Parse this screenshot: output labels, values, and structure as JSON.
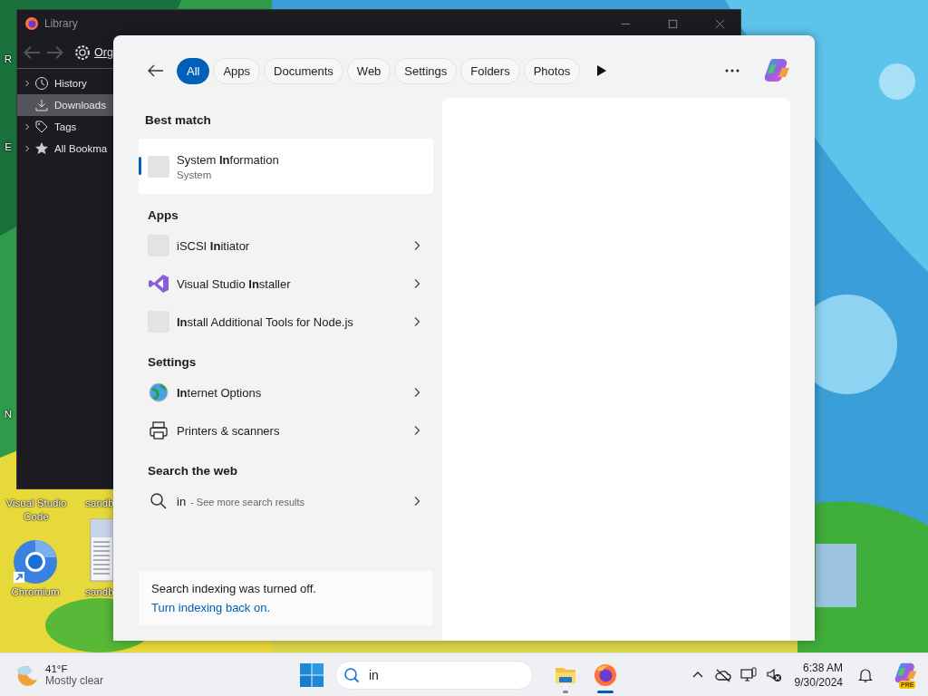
{
  "desktop_icons": [
    {
      "label": "R",
      "kind": "cut"
    },
    {
      "label": "E",
      "kind": "cut"
    },
    {
      "label": "N",
      "kind": "cut"
    },
    {
      "label": "Visual Studio Code",
      "kind": "vscode"
    },
    {
      "label": "sandb",
      "kind": "cut"
    },
    {
      "label": "Chromium",
      "kind": "chromium"
    },
    {
      "label": "sandb",
      "kind": "document"
    }
  ],
  "library_window": {
    "title": "Library",
    "navigation": [
      {
        "kind": "back",
        "disabled": true
      },
      {
        "kind": "forward",
        "disabled": true
      }
    ],
    "organize": "Org",
    "sidebar": [
      {
        "label": "History",
        "kind": "history",
        "expanded": false,
        "selected": false
      },
      {
        "label": "Downloads",
        "kind": "downloads",
        "selected": true
      },
      {
        "label": "Tags",
        "kind": "tags",
        "expanded": false,
        "selected": false
      },
      {
        "label": "All Bookma",
        "kind": "bookmarks",
        "expanded": false,
        "selected": false
      }
    ]
  },
  "search_panel": {
    "filters": [
      {
        "label": "All",
        "selected": true
      },
      {
        "label": "Apps",
        "selected": false
      },
      {
        "label": "Documents",
        "selected": false
      },
      {
        "label": "Web",
        "selected": false
      },
      {
        "label": "Settings",
        "selected": false
      },
      {
        "label": "Folders",
        "selected": false
      },
      {
        "label": "Photos",
        "selected": false
      }
    ],
    "sections": [
      {
        "title": "Best match",
        "items": [
          {
            "kind": "blank",
            "title": "System **In**formation",
            "subtitle": "System",
            "selected": true
          }
        ]
      },
      {
        "title": "Apps",
        "items": [
          {
            "kind": "blank",
            "title": "iSCSI **In**itiator",
            "selected": false
          },
          {
            "kind": "vs",
            "title": "Visual Studio **In**staller",
            "selected": false
          },
          {
            "kind": "blank",
            "title": "**In**stall Additional Tools for Node.js",
            "selected": false
          }
        ]
      },
      {
        "title": "Settings",
        "items": [
          {
            "kind": "internet",
            "title": "**In**ternet Options",
            "selected": false
          },
          {
            "kind": "printer",
            "title": "Printers & scanners",
            "selected": false
          }
        ]
      },
      {
        "title": "Search the web",
        "items": [
          {
            "kind": "web",
            "title": "in",
            "subtitle": "- See more search results",
            "selected": false
          }
        ]
      }
    ],
    "notice": {
      "text": "Search indexing was turned off.",
      "link": "Turn indexing back on."
    }
  },
  "taskbar": {
    "weather": {
      "temperature": "41°F",
      "condition": "Mostly clear"
    },
    "search": {
      "value": "in"
    },
    "apps": [
      {
        "kind": "explorer",
        "active": false
      },
      {
        "kind": "firefox",
        "active": true
      }
    ],
    "clock": {
      "time": "6:38 AM",
      "date": "9/30/2024"
    },
    "copilot_badge": "PRE"
  }
}
